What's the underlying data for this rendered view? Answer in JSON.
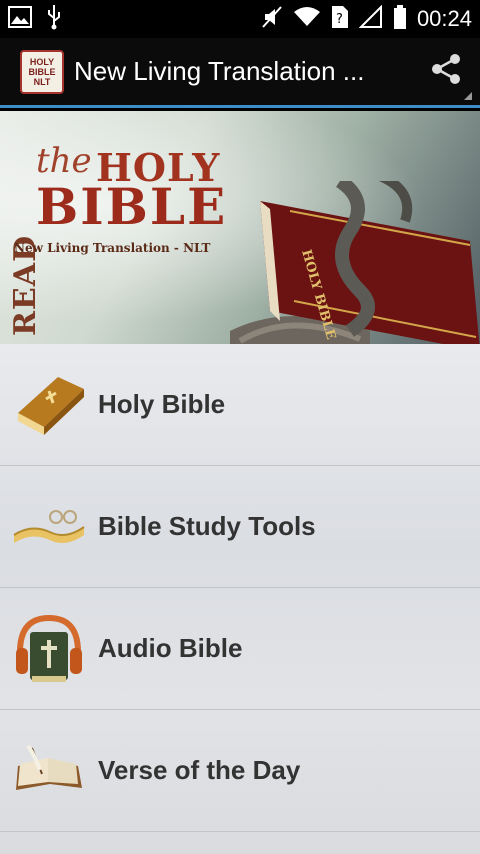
{
  "status_bar": {
    "time": "00:24",
    "icons": [
      "image-icon",
      "usb-icon",
      "mute-icon",
      "wifi-icon",
      "unknown-sim-icon",
      "signal-icon",
      "battery-icon"
    ]
  },
  "action_bar": {
    "title": "New Living Translation ...",
    "app_icon_text": [
      "HOLY",
      "BIBLE",
      "NLT"
    ],
    "share_icon": "share-icon"
  },
  "banner": {
    "read": "READ",
    "the": "the",
    "holy": "HOLY",
    "bible": "BIBLE",
    "subtitle": "New Living Translation - NLT",
    "book_spine": "HOLY BIBLE"
  },
  "menu": {
    "items": [
      {
        "label": "Holy Bible",
        "icon": "book-icon"
      },
      {
        "label": "Bible Study Tools",
        "icon": "scroll-glasses-icon"
      },
      {
        "label": "Audio Bible",
        "icon": "headphones-bible-icon"
      },
      {
        "label": "Verse of the Day",
        "icon": "open-book-quill-icon"
      }
    ]
  },
  "colors": {
    "accent_line": "#3d8dc8",
    "banner_title": "#9c2b1b"
  }
}
